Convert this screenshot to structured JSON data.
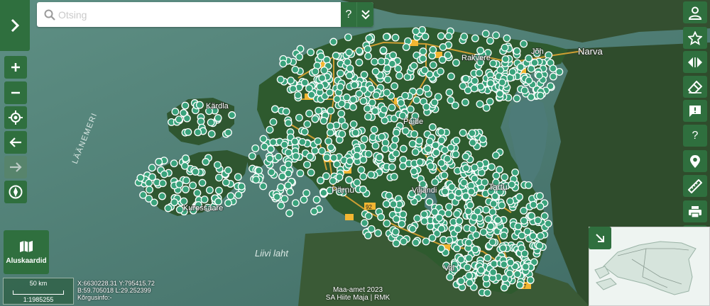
{
  "search": {
    "placeholder": "Otsing",
    "help_label": "?"
  },
  "basemaps": {
    "label": "Aluskaardid"
  },
  "scale": {
    "bar_label": "50 km",
    "ratio": "1:1985255"
  },
  "coords": {
    "xy": "X:6630228.31 Y:795415.72",
    "bl": "B:59.705018 L:29.252399",
    "height": "Kõrgusinfo:-"
  },
  "attribution": {
    "line1": "Maa-amet 2023",
    "line2": "SA Hiite Maja | RMK"
  },
  "map_labels": {
    "narva": "Narva",
    "johvi": "Jõh",
    "kardla": "Kärdla",
    "kuressaare": "Kuressaare",
    "parnu": "Pärnu",
    "paide": "Paide",
    "viljandi": "Viljandi",
    "tartu": "Tartu",
    "valga": "Val",
    "rakvere": "Rakvere",
    "laanemeri": "LÄÄNEMERI",
    "liivi_laht": "Liivi laht"
  },
  "road_shields": [
    "7",
    "92"
  ],
  "marker_count_note": "",
  "colors": {
    "accent": "#2f6f3e",
    "marker": "#3aa37c",
    "marker_stroke": "#ffffff",
    "water": "#4f7d74",
    "land": "#30502f",
    "road": "#e0a634"
  },
  "icons": {
    "expand": "chevron-right-icon",
    "zoom_in": "plus-icon",
    "zoom_out": "minus-icon",
    "locate": "crosshair-icon",
    "back": "arrow-left-icon",
    "forward": "arrow-right-icon",
    "compass": "compass-icon",
    "basemaps": "map-icon",
    "user": "user-icon",
    "favorites": "star-icon",
    "compare": "swap-icon",
    "eraser": "eraser-icon",
    "feedback": "feedback-icon",
    "help": "help-icon",
    "marker": "pin-icon",
    "measure": "ruler-icon",
    "print": "print-icon",
    "collapse": "chevron-up-icon"
  }
}
